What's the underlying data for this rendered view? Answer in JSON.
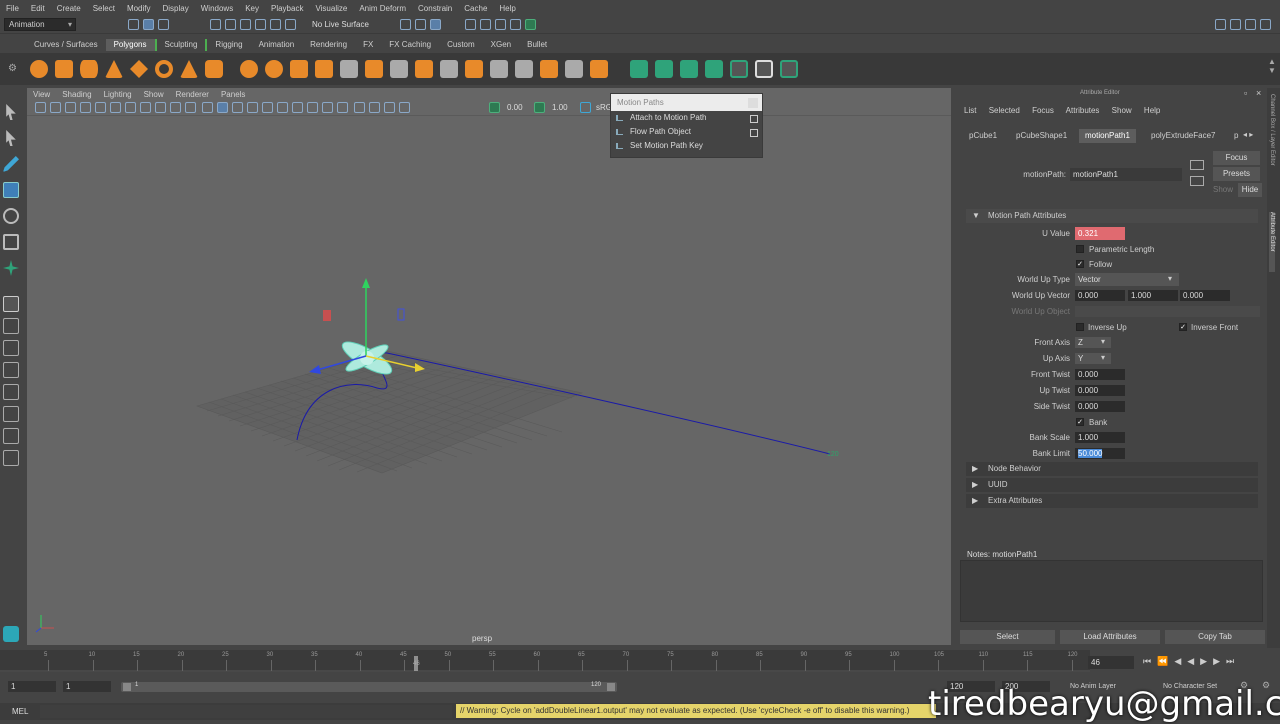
{
  "menubar": {
    "items": [
      "File",
      "Edit",
      "Create",
      "Select",
      "Modify",
      "Display",
      "Windows",
      "Key",
      "Playback",
      "Visualize",
      "Anim Deform",
      "Constrain",
      "Cache",
      "Help"
    ]
  },
  "status": {
    "mode": "Animation",
    "live_surface": "No Live Surface"
  },
  "shelf": {
    "tabs": [
      "Curves / Surfaces",
      "Polygons",
      "Sculpting",
      "Rigging",
      "Animation",
      "Rendering",
      "FX",
      "FX Caching",
      "Custom",
      "XGen",
      "Bullet"
    ],
    "active": "Polygons"
  },
  "viewport": {
    "menus": [
      "View",
      "Shading",
      "Lighting",
      "Show",
      "Renderer",
      "Panels"
    ],
    "camera": "persp",
    "val1": "0.00",
    "val2": "1.00",
    "srgb": "sRG",
    "curve_end": "120"
  },
  "popup": {
    "title": "Motion Paths",
    "items": [
      "Attach to Motion Path",
      "Flow Path Object",
      "Set Motion Path Key"
    ]
  },
  "attr_editor": {
    "title": "Attribute Editor",
    "menus": [
      "List",
      "Selected",
      "Focus",
      "Attributes",
      "Show",
      "Help"
    ],
    "tabs": [
      "pCube1",
      "pCubeShape1",
      "motionPath1",
      "polyExtrudeFace7",
      "p"
    ],
    "active_tab": "motionPath1",
    "node_label": "motionPath:",
    "node_value": "motionPath1",
    "focus": "Focus",
    "presets": "Presets",
    "show": "Show",
    "hide": "Hide",
    "section": "Motion Path Attributes",
    "u_value_label": "U Value",
    "u_value": "0.321",
    "parametric_length": "Parametric Length",
    "follow": "Follow",
    "world_up_type_label": "World Up Type",
    "world_up_type": "Vector",
    "world_up_vector_label": "World Up Vector",
    "wuv": [
      "0.000",
      "1.000",
      "0.000"
    ],
    "world_up_object_label": "World Up Object",
    "inverse_up": "Inverse Up",
    "inverse_front": "Inverse Front",
    "front_axis_label": "Front Axis",
    "front_axis": "Z",
    "up_axis_label": "Up Axis",
    "up_axis": "Y",
    "front_twist_label": "Front Twist",
    "front_twist": "0.000",
    "up_twist_label": "Up Twist",
    "up_twist": "0.000",
    "side_twist_label": "Side Twist",
    "side_twist": "0.000",
    "bank": "Bank",
    "bank_scale_label": "Bank Scale",
    "bank_scale": "1.000",
    "bank_limit_label": "Bank Limit",
    "bank_limit": "50.000",
    "collapsed": [
      "Node Behavior",
      "UUID",
      "Extra Attributes"
    ],
    "notes": "Notes: motionPath1",
    "buttons": [
      "Select",
      "Load Attributes",
      "Copy Tab"
    ]
  },
  "side_tabs": "Channel Box / Layer Editor",
  "side_tabs2": "Attribute Editor",
  "timeline": {
    "ticks": [
      "5",
      "10",
      "15",
      "20",
      "25",
      "30",
      "35",
      "40",
      "45",
      "50",
      "55",
      "60",
      "65",
      "70",
      "75",
      "80",
      "85",
      "90",
      "95",
      "100",
      "105",
      "110",
      "115",
      "120"
    ],
    "current": "46",
    "current_frame": "46"
  },
  "range": {
    "start": "1",
    "start2": "1",
    "slider_start": "1",
    "slider_end": "120",
    "end": "120",
    "end2": "200",
    "anim_layer": "No Anim Layer",
    "char_set": "No Character Set"
  },
  "cmd": {
    "lang": "MEL",
    "warning": "// Warning: Cycle on 'addDoubleLinear1.output' may not evaluate as expected.  (Use 'cycleCheck -e off' to disable this warning.)"
  },
  "watermark": "tiredbearyu@gmail.com"
}
